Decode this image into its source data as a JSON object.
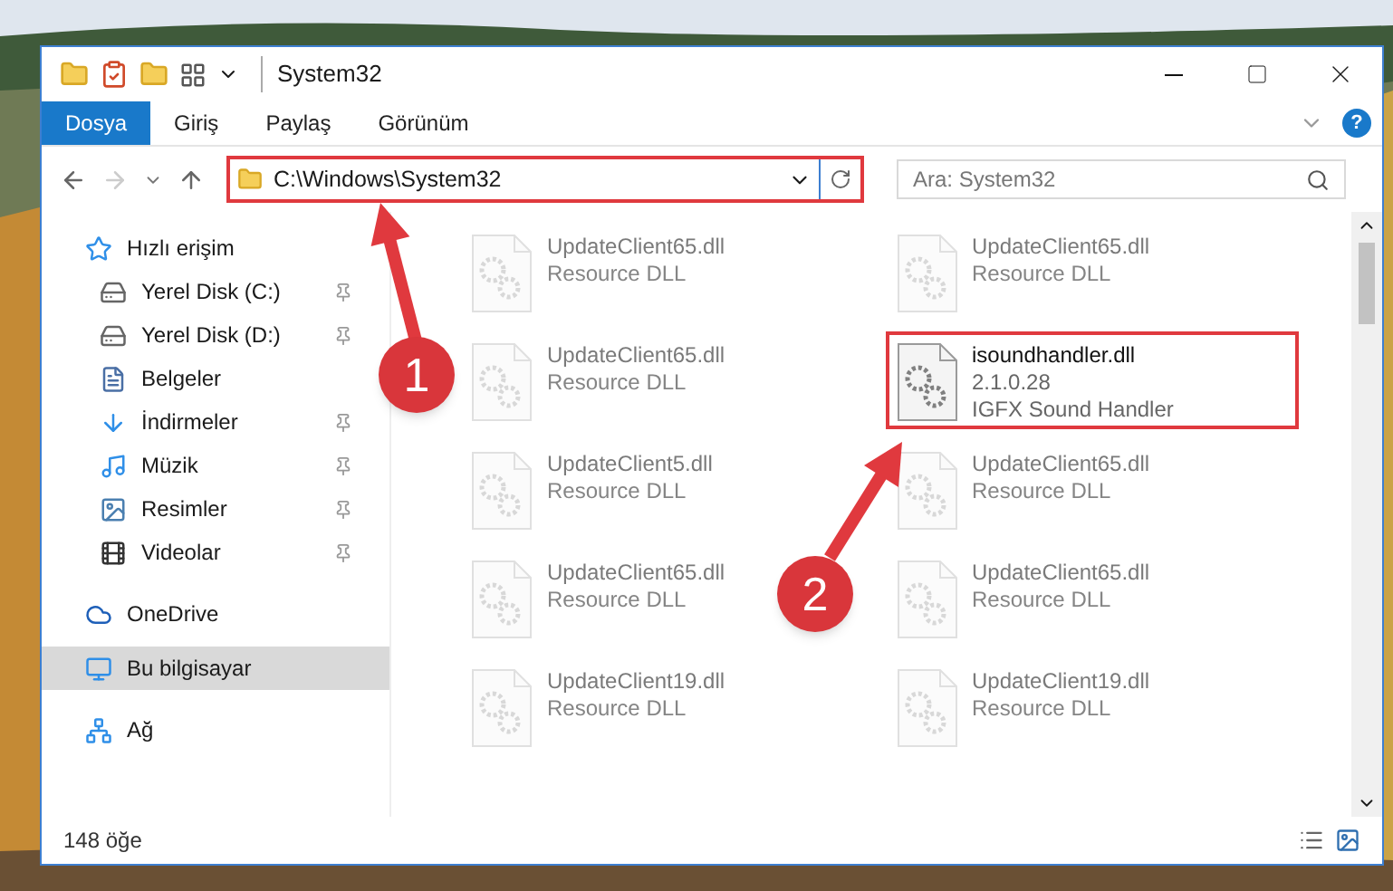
{
  "window": {
    "title": "System32"
  },
  "ribbon_tabs": [
    {
      "label": "Dosya",
      "selected": true
    },
    {
      "label": "Giriş",
      "selected": false
    },
    {
      "label": "Paylaş",
      "selected": false
    },
    {
      "label": "Görünüm",
      "selected": false
    }
  ],
  "help": "?",
  "address": {
    "path": "C:\\Windows\\System32"
  },
  "search": {
    "placeholder": "Ara: System32"
  },
  "sidebar": {
    "items": [
      {
        "label": "Hızlı erişim",
        "kind": "quick",
        "pinned": false,
        "selected": false
      },
      {
        "label": "Yerel Disk (C:)",
        "kind": "windrive",
        "pinned": true,
        "selected": false
      },
      {
        "label": "Yerel Disk (D:)",
        "kind": "drive",
        "pinned": true,
        "selected": false
      },
      {
        "label": "Belgeler",
        "kind": "documents",
        "pinned": false,
        "selected": false
      },
      {
        "label": "İndirmeler",
        "kind": "downloads",
        "pinned": true,
        "selected": false
      },
      {
        "label": "Müzik",
        "kind": "music",
        "pinned": true,
        "selected": false
      },
      {
        "label": "Resimler",
        "kind": "pictures",
        "pinned": true,
        "selected": false
      },
      {
        "label": "Videolar",
        "kind": "videos",
        "pinned": true,
        "selected": false
      },
      {
        "label": "OneDrive",
        "kind": "cloud",
        "pinned": false,
        "selected": false
      },
      {
        "label": "Bu bilgisayar",
        "kind": "computer",
        "pinned": false,
        "selected": true
      },
      {
        "label": "Ağ",
        "kind": "network",
        "pinned": false,
        "selected": false
      }
    ]
  },
  "files": [
    {
      "name": "UpdateClient65.dll",
      "lines": [
        "Resource DLL"
      ],
      "blurred": true,
      "selected": false
    },
    {
      "name": "UpdateClient65.dll",
      "lines": [
        "Resource DLL"
      ],
      "blurred": true,
      "selected": false
    },
    {
      "name": "UpdateClient65.dll",
      "lines": [
        "Resource DLL"
      ],
      "blurred": true,
      "selected": false
    },
    {
      "name": "isoundhandler.dll",
      "lines": [
        "2.1.0.28",
        "IGFX Sound Handler"
      ],
      "blurred": false,
      "selected": true
    },
    {
      "name": "UpdateClient5.dll",
      "lines": [
        "Resource DLL"
      ],
      "blurred": true,
      "selected": false
    },
    {
      "name": "UpdateClient65.dll",
      "lines": [
        "Resource DLL"
      ],
      "blurred": true,
      "selected": false
    },
    {
      "name": "UpdateClient65.dll",
      "lines": [
        "Resource DLL"
      ],
      "blurred": true,
      "selected": false
    },
    {
      "name": "UpdateClient65.dll",
      "lines": [
        "Resource DLL"
      ],
      "blurred": true,
      "selected": false
    },
    {
      "name": "UpdateClient19.dll",
      "lines": [
        "Resource DLL"
      ],
      "blurred": true,
      "selected": false
    },
    {
      "name": "UpdateClient19.dll",
      "lines": [
        "Resource DLL"
      ],
      "blurred": true,
      "selected": false
    }
  ],
  "status_bar": {
    "count": "148 öğe"
  },
  "annotations": [
    {
      "label": "1"
    },
    {
      "label": "2"
    }
  ]
}
